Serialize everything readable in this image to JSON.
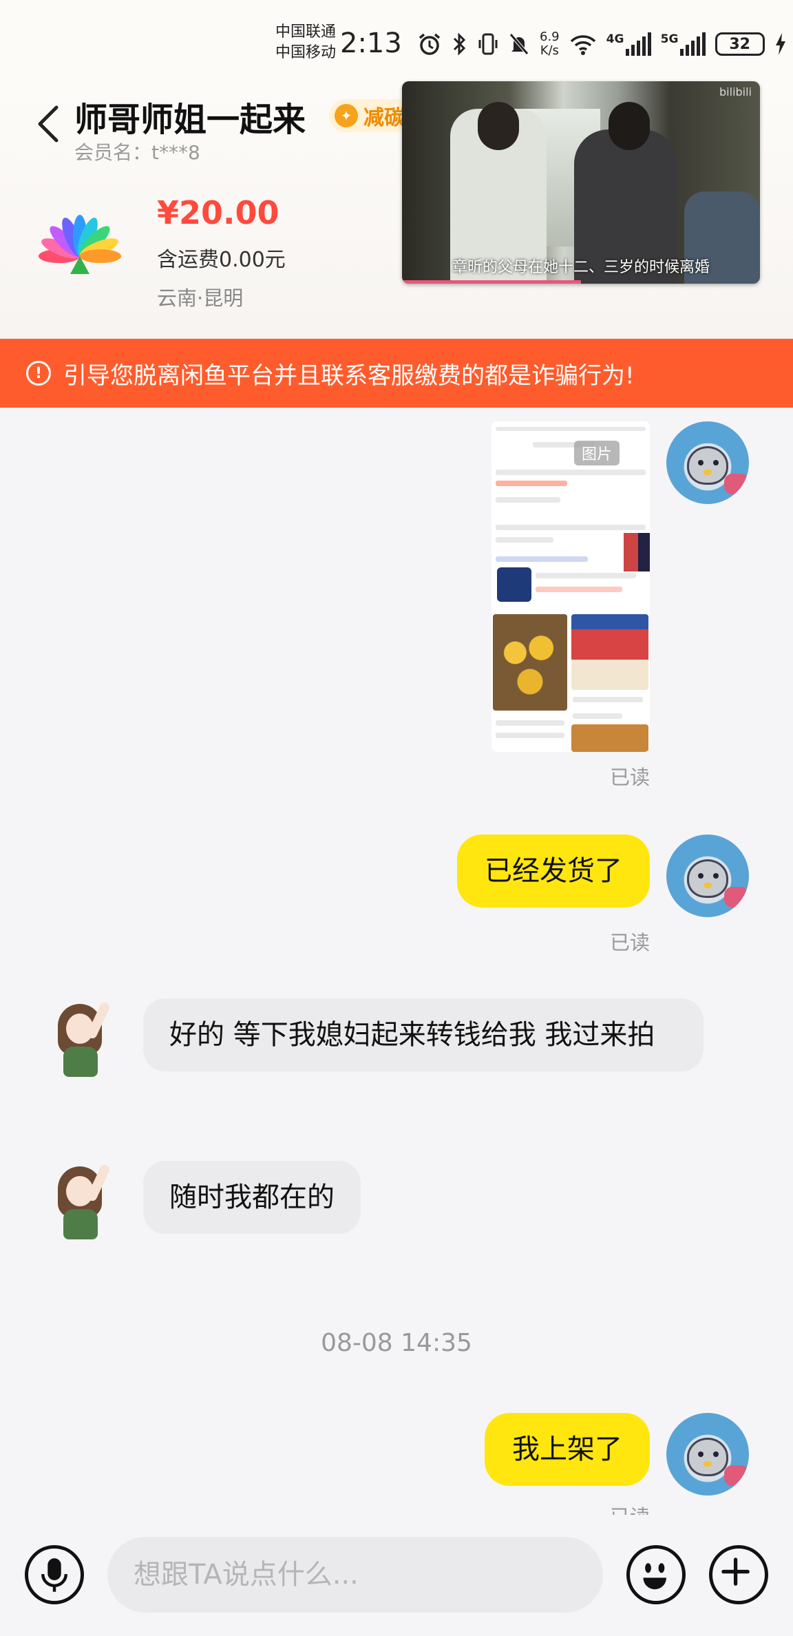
{
  "status_bar": {
    "carrier1": "中国联通",
    "carrier2": "中国移动",
    "time": "2:13",
    "net_speed_value": "6.9",
    "net_speed_unit": "K/s",
    "signal1_tag": "4G",
    "signal2_tag": "5G",
    "battery": "32",
    "icons": [
      "alarm-icon",
      "bluetooth-icon",
      "vibrate-icon",
      "mute-icon",
      "wifi-icon",
      "signal-icon",
      "battery-icon",
      "charging-icon"
    ]
  },
  "header": {
    "title": "师哥师姐一起来",
    "badge": "减碳",
    "member_label": "会员名：t***8",
    "price": "¥20.00",
    "shipping": "含运费0.00元",
    "location": "云南·昆明"
  },
  "video": {
    "subtitle": "章昕的父母在她十二、三岁的时候离婚",
    "watermark": "bilibili",
    "progress": 0.5
  },
  "warning": {
    "text": "引导您脱离闲鱼平台并且联系客服缴费的都是诈骗行为!"
  },
  "chat": {
    "image_tag": "图片",
    "messages": [
      {
        "sender": "me",
        "type": "image",
        "status": "已读"
      },
      {
        "sender": "me",
        "type": "text",
        "text": "已经发货了",
        "status": "已读"
      },
      {
        "sender": "other",
        "type": "text",
        "text": "好的 等下我媳妇起来转钱给我 我过来拍"
      },
      {
        "sender": "other",
        "type": "text",
        "text": "随时我都在的"
      },
      {
        "sender": "me",
        "type": "text",
        "text": "我上架了",
        "status": "已读"
      }
    ],
    "timestamp": "08-08 14:35"
  },
  "input_bar": {
    "placeholder": "想跟TA说点什么..."
  },
  "colors": {
    "accent_yellow": "#ffe60f",
    "warning_orange": "#ff5c2d",
    "price_red": "#ff4a3d"
  }
}
